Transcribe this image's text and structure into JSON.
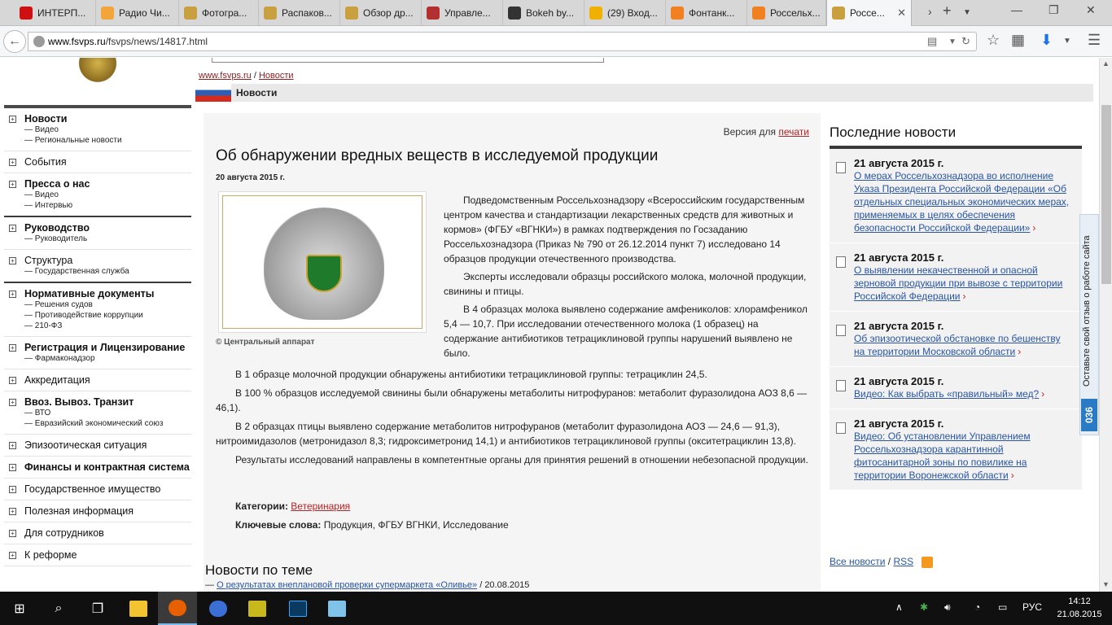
{
  "browser": {
    "tabs": [
      {
        "label": "ИНТЕРП...",
        "icon": "interp-favicon-icon",
        "color": "#d01010"
      },
      {
        "label": "Радио Чи...",
        "icon": "radio-favicon-icon",
        "color": "#f3a53a"
      },
      {
        "label": "Фотогра...",
        "icon": "photo-favicon-icon",
        "color": "#c9a040"
      },
      {
        "label": "Распаков...",
        "icon": "unpack-favicon-icon",
        "color": "#c9a040"
      },
      {
        "label": "Обзор др...",
        "icon": "review-favicon-icon",
        "color": "#c9a040"
      },
      {
        "label": "Управле...",
        "icon": "gov-favicon-icon",
        "color": "#b23030"
      },
      {
        "label": "Bokeh by...",
        "icon": "bokeh-favicon-icon",
        "color": "#333333"
      },
      {
        "label": "(29) Вход...",
        "icon": "mail-favicon-icon",
        "color": "#f0b000"
      },
      {
        "label": "Фонтанк...",
        "icon": "fontanka-favicon-icon",
        "color": "#f08020"
      },
      {
        "label": "Россельх...",
        "icon": "rsh-favicon-icon",
        "color": "#f08020"
      },
      {
        "label": "Россе...",
        "icon": "rosselhoz-favicon-icon",
        "color": "#c9a040"
      }
    ],
    "url_domain": "www.fsvps.ru",
    "url_path": "/fsvps/news/14817.html"
  },
  "site": {
    "breadcrumb_home": "www.fsvps.ru",
    "breadcrumb_sep": "/",
    "breadcrumb_news": "Новости",
    "section_title": "Новости"
  },
  "sidebar": [
    {
      "label": "Новости",
      "bold": true,
      "subs": [
        "— Видео",
        "— Региональные новости"
      ]
    },
    {
      "label": "События",
      "bold": false,
      "subs": []
    },
    {
      "label": "Пресса о нас",
      "bold": true,
      "subs": [
        "— Видео",
        "— Интервью"
      ],
      "heavy": true
    },
    {
      "label": "Руководство",
      "bold": true,
      "subs": [
        "— Руководитель"
      ]
    },
    {
      "label": "Структура",
      "bold": false,
      "subs": [
        "— Государственная служба"
      ],
      "heavy": true
    },
    {
      "label": "Нормативные документы",
      "bold": true,
      "subs": [
        "— Решения судов",
        "— Противодействие коррупции",
        "— 210-ФЗ"
      ]
    },
    {
      "label": "Регистрация и Лицензирование",
      "bold": true,
      "subs": [
        "— Фармаконадзор"
      ]
    },
    {
      "label": "Аккредитация",
      "bold": false,
      "subs": []
    },
    {
      "label": "Ввоз. Вывоз. Транзит",
      "bold": true,
      "subs": [
        "— ВТО",
        "— Евразийский экономический союз"
      ]
    },
    {
      "label": "Эпизоотическая ситуация",
      "bold": false,
      "subs": []
    },
    {
      "label": "Финансы и контрактная система",
      "bold": true,
      "subs": []
    },
    {
      "label": "Государственное имущество",
      "bold": false,
      "subs": []
    },
    {
      "label": "Полезная информация",
      "bold": false,
      "subs": []
    },
    {
      "label": "Для сотрудников",
      "bold": false,
      "subs": []
    },
    {
      "label": "К реформе",
      "bold": false,
      "subs": []
    }
  ],
  "article": {
    "print_prefix": "Версия для",
    "print_link": "печати",
    "title": "Об обнаружении вредных веществ в исследуемой продукции",
    "date": "20 августа 2015 г.",
    "image_caption": "© Центральный аппарат",
    "paragraphs_right": [
      "Подведомственным Россельхознадзору «Всероссийским государственным центром качества и стандартизации лекарственных средств для животных и кормов» (ФГБУ «ВГНКИ») в рамках подтверждения по Госзаданию Россельхознадзора (Приказ № 790 от 26.12.2014 пункт 7) исследовано 14 образцов продукции отечественного производства.",
      "Эксперты исследовали образцы российского молока, молочной продукции, свинины и птицы.",
      "В 4 образцах молока выявлено содержание амфениколов: хлорамфеникол 5,4 — 10,7. При исследовании отечественного молока (1 образец) на содержание антибиотиков тетрациклиновой группы нарушений выявлено не было."
    ],
    "paragraphs_full": [
      "В 1 образце молочной продукции обнаружены антибиотики тетрациклиновой группы: тетрациклин 24,5.",
      "В 100 % образцов исследуемой свинины были обнаружены метаболиты нитрофуранов: метаболит фуразолидона АОЗ 8,6 — 46,1).",
      "В 2 образцах птицы выявлено содержание метаболитов нитрофуранов (метаболит фуразолидона АОЗ — 24,6 — 91,3), нитроимидазолов (метронидазол 8,3; гидроксиметронид 14,1) и антибиотиков тетрациклиновой группы (окситетрациклин 13,8).",
      "Результаты исследований направлены в компетентные органы для принятия решений в отношении небезопасной продукции."
    ],
    "categories_label": "Категории:",
    "categories_value": "Ветеринария",
    "keywords_label": "Ключевые слова:",
    "keywords_value": "Продукция, ФГБУ ВГНКИ, Исследование"
  },
  "related": {
    "title": "Новости по теме",
    "dash": "—",
    "link": "О результатах внеплановой проверки супермаркета «Оливье»",
    "date": "/ 20.08.2015"
  },
  "latest": {
    "title": "Последние новости",
    "items": [
      {
        "date": "21 августа 2015 г.",
        "text": "О мерах Россельхознадзора во исполнение Указа Президента Российской Федерации «Об отдельных специальных экономических мерах, применяемых в целях обеспечения безопасности Российской Федерации»"
      },
      {
        "date": "21 августа 2015 г.",
        "text": "О выявлении некачественной и опасной зерновой продукции при вывозе с территории Российской Федерации"
      },
      {
        "date": "21 августа 2015 г.",
        "text": "Об эпизоотической обстановке по бешенству на территории Московской области"
      },
      {
        "date": "21 августа 2015 г.",
        "text": "Видео: Как выбрать «правильный» мед?"
      },
      {
        "date": "21 августа 2015 г.",
        "text": "Видео: Об установлении Управлением Россельхознадзора карантинной фитосанитарной зоны по повилике на территории Воронежской области"
      }
    ],
    "all_news": "Все новости",
    "sep": "/",
    "rss": "RSS"
  },
  "feedback": {
    "text": "Оставьте свой отзыв о работе сайта",
    "badge": "036"
  },
  "taskbar": {
    "lang": "РУС",
    "time": "14:12",
    "date": "21.08.2015"
  }
}
